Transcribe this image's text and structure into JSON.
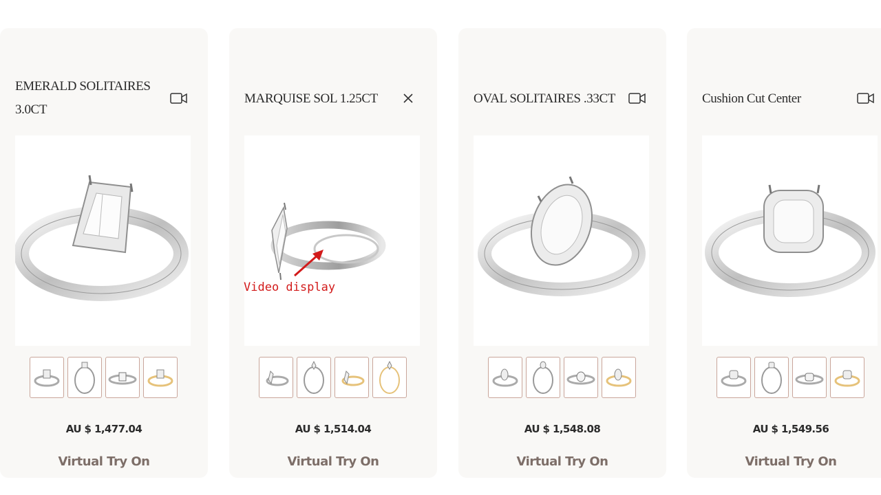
{
  "products": [
    {
      "title_line1": "EMERALD SOLITAIRES",
      "title_line2": "3.0CT",
      "price": "AU $ 1,477.04",
      "try_on": "Virtual Try On",
      "media_control": "video-camera-icon"
    },
    {
      "title_line1": "MARQUISE SOL 1.25CT",
      "title_line2": "",
      "price": "AU $ 1,514.04",
      "try_on": "Virtual Try On",
      "media_control": "close-icon"
    },
    {
      "title_line1": "OVAL SOLITAIRES .33CT",
      "title_line2": "",
      "price": "AU $ 1,548.08",
      "try_on": "Virtual Try On",
      "media_control": "video-camera-icon"
    },
    {
      "title_line1": "Cushion Cut Center",
      "title_line2": "",
      "price": "AU $ 1,549.56",
      "try_on": "Virtual Try On",
      "media_control": "video-camera-icon"
    }
  ],
  "annotation": {
    "text": "Video display",
    "color": "#d21a1a"
  },
  "colors": {
    "card_bg": "#f9f8f6",
    "thumb_border": "#c9a59a",
    "try_on_text": "#7d6e68",
    "gold": "#e6c27a"
  }
}
